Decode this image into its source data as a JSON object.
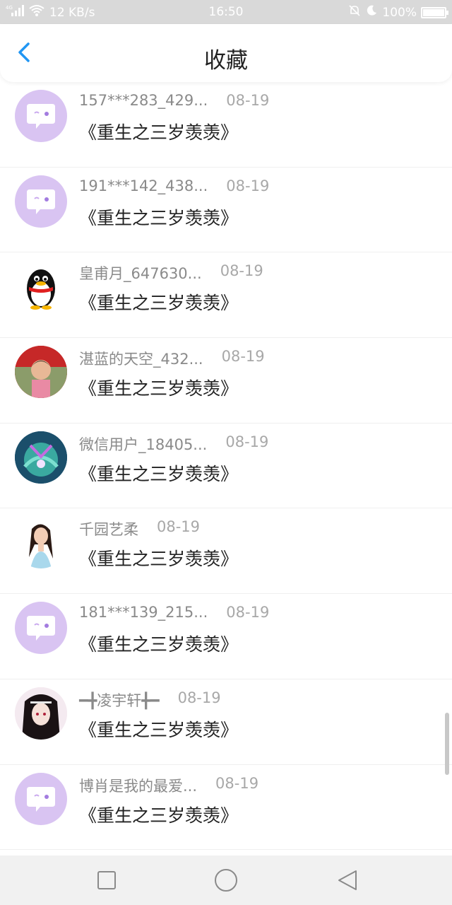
{
  "status_bar": {
    "network": "4G",
    "speed": "12 KB/s",
    "time": "16:50",
    "battery_text": "100%",
    "battery_level": 1.0
  },
  "header": {
    "title": "收藏",
    "back_icon": "chevron-left-icon"
  },
  "colors": {
    "accent": "#2196f3",
    "avatar_purple": "#d9c4f2",
    "status_bar": "#d9d9d9"
  },
  "items": [
    {
      "name": "157***283_429...",
      "date": "08-19",
      "book": "《重生之三岁羡羡》",
      "avatar": "chat-bubble"
    },
    {
      "name": "191***142_438...",
      "date": "08-19",
      "book": "《重生之三岁羡羡》",
      "avatar": "chat-bubble"
    },
    {
      "name": "皇甫月_647630...",
      "date": "08-19",
      "book": "《重生之三岁羡羡》",
      "avatar": "penguin"
    },
    {
      "name": "湛蓝的天空_432...",
      "date": "08-19",
      "book": "《重生之三岁羡羡》",
      "avatar": "child-photo"
    },
    {
      "name": "微信用户_18405...",
      "date": "08-19",
      "book": "《重生之三岁羡羡》",
      "avatar": "anime-art"
    },
    {
      "name": "千园艺柔",
      "date": "08-19",
      "book": "《重生之三岁羡羡》",
      "avatar": "woman-photo"
    },
    {
      "name": "181***139_215...",
      "date": "08-19",
      "book": "《重生之三岁羡羡》",
      "avatar": "chat-bubble"
    },
    {
      "name": "━╋凌宇轩╋━",
      "date": "08-19",
      "book": "《重生之三岁羡羡》",
      "avatar": "anime-character"
    },
    {
      "name": "博肖是我的最爱...",
      "date": "08-19",
      "book": "《重生之三岁羡羡》",
      "avatar": "chat-bubble"
    }
  ],
  "nav": {
    "recent": "square-icon",
    "home": "circle-icon",
    "back": "triangle-back-icon"
  }
}
